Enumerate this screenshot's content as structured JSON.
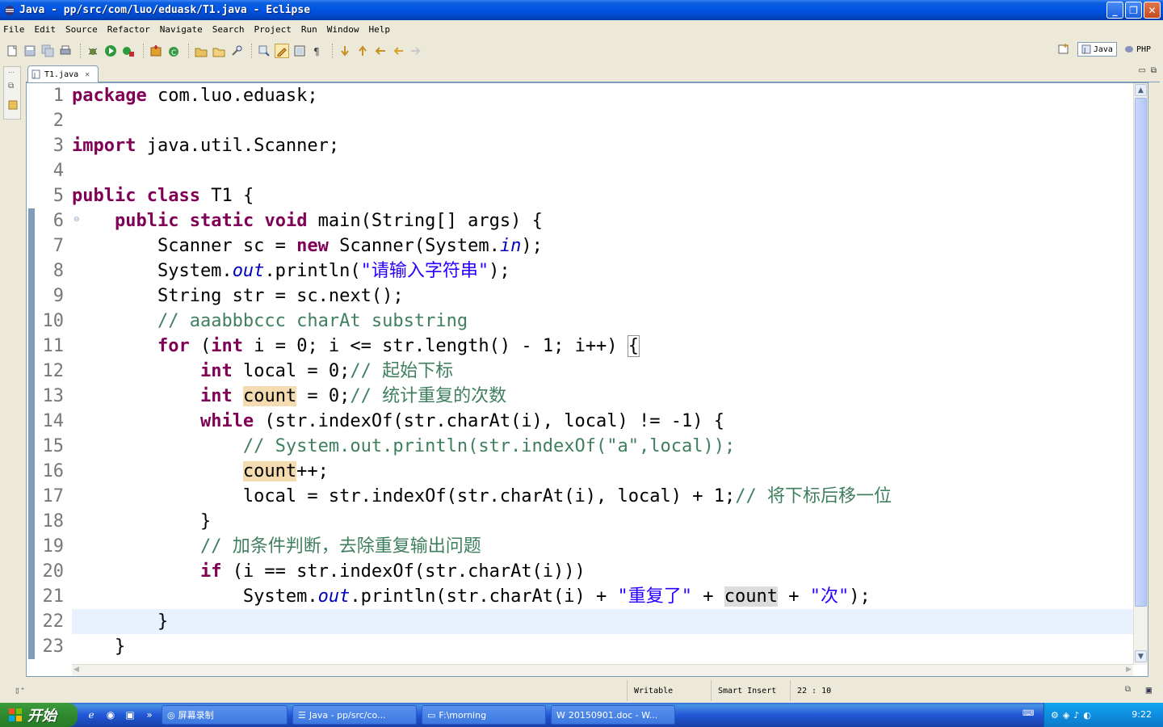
{
  "window": {
    "title": "Java - pp/src/com/luo/eduask/T1.java - Eclipse"
  },
  "menu": [
    {
      "label": "File",
      "mnemonic": "F",
      "rest": "ile"
    },
    {
      "label": "Edit",
      "mnemonic": "E",
      "rest": "dit"
    },
    {
      "label": "Source",
      "mnemonic": "S",
      "rest": "ource"
    },
    {
      "label": "Refactor",
      "mnemonic": "",
      "rest": "Refactor"
    },
    {
      "label": "Navigate",
      "mnemonic": "N",
      "rest": "avigate"
    },
    {
      "label": "Search",
      "mnemonic": "",
      "rest": "Search"
    },
    {
      "label": "Project",
      "mnemonic": "P",
      "rest": "roject"
    },
    {
      "label": "Run",
      "mnemonic": "R",
      "rest": "un"
    },
    {
      "label": "Window",
      "mnemonic": "W",
      "rest": "indow"
    },
    {
      "label": "Help",
      "mnemonic": "H",
      "rest": "elp"
    }
  ],
  "perspectives": {
    "java": "Java",
    "php": "PHP"
  },
  "editor": {
    "tab_label": "T1.java",
    "lines": [
      {
        "n": "1",
        "segs": [
          [
            "kw",
            "package"
          ],
          [
            "",
            " com.luo.eduask;"
          ]
        ]
      },
      {
        "n": "2",
        "segs": []
      },
      {
        "n": "3",
        "segs": [
          [
            "kw",
            "import"
          ],
          [
            "",
            " java.util.Scanner;"
          ]
        ]
      },
      {
        "n": "4",
        "segs": []
      },
      {
        "n": "5",
        "segs": [
          [
            "kw",
            "public"
          ],
          [
            "",
            " "
          ],
          [
            "kw",
            "class"
          ],
          [
            "",
            " T1 {"
          ]
        ]
      },
      {
        "n": "6",
        "segs": [
          [
            "",
            "    "
          ],
          [
            "kw",
            "public"
          ],
          [
            "",
            " "
          ],
          [
            "kw",
            "static"
          ],
          [
            "",
            " "
          ],
          [
            "kw",
            "void"
          ],
          [
            "",
            " main(String[] args) {"
          ]
        ]
      },
      {
        "n": "7",
        "segs": [
          [
            "",
            "        Scanner sc = "
          ],
          [
            "kw",
            "new"
          ],
          [
            "",
            " Scanner(System."
          ],
          [
            "fld",
            "in"
          ],
          [
            "",
            ");"
          ]
        ]
      },
      {
        "n": "8",
        "segs": [
          [
            "",
            "        System."
          ],
          [
            "fld",
            "out"
          ],
          [
            "",
            ".println("
          ],
          [
            "str",
            "\"请输入字符串\""
          ],
          [
            "",
            ");"
          ]
        ]
      },
      {
        "n": "9",
        "segs": [
          [
            "",
            "        String str = sc.next();"
          ]
        ]
      },
      {
        "n": "10",
        "segs": [
          [
            "",
            "        "
          ],
          [
            "cm",
            "// aaabbbccc charAt substring"
          ]
        ]
      },
      {
        "n": "11",
        "segs": [
          [
            "",
            "        "
          ],
          [
            "kw",
            "for"
          ],
          [
            "",
            " ("
          ],
          [
            "kw",
            "int"
          ],
          [
            "",
            " i = 0; i <= str.length() - 1; i++) "
          ],
          [
            "brk",
            "{"
          ]
        ]
      },
      {
        "n": "12",
        "segs": [
          [
            "",
            "            "
          ],
          [
            "kw",
            "int"
          ],
          [
            "",
            " local = 0;"
          ],
          [
            "cm",
            "// 起始下标"
          ]
        ]
      },
      {
        "n": "13",
        "segs": [
          [
            "",
            "            "
          ],
          [
            "kw",
            "int"
          ],
          [
            "",
            " "
          ],
          [
            "occ",
            "count"
          ],
          [
            "",
            " = 0;"
          ],
          [
            "cm",
            "// 统计重复的次数"
          ]
        ]
      },
      {
        "n": "14",
        "segs": [
          [
            "",
            "            "
          ],
          [
            "kw",
            "while"
          ],
          [
            "",
            " (str.indexOf(str.charAt(i), local) != -1) {"
          ]
        ]
      },
      {
        "n": "15",
        "segs": [
          [
            "",
            "                "
          ],
          [
            "cm",
            "// System.out.println(str.indexOf(\"a\",local));"
          ]
        ]
      },
      {
        "n": "16",
        "segs": [
          [
            "",
            "                "
          ],
          [
            "occ",
            "count"
          ],
          [
            "",
            "++;"
          ]
        ]
      },
      {
        "n": "17",
        "segs": [
          [
            "",
            "                local = str.indexOf(str.charAt(i), local) + 1;"
          ],
          [
            "cm",
            "// 将下标后移一位"
          ]
        ]
      },
      {
        "n": "18",
        "segs": [
          [
            "",
            "            }"
          ]
        ]
      },
      {
        "n": "19",
        "segs": [
          [
            "",
            "            "
          ],
          [
            "cm",
            "// 加条件判断，去除重复输出问题"
          ]
        ]
      },
      {
        "n": "20",
        "segs": [
          [
            "",
            "            "
          ],
          [
            "kw",
            "if"
          ],
          [
            "",
            " (i == str.indexOf(str.charAt(i)))"
          ]
        ]
      },
      {
        "n": "21",
        "segs": [
          [
            "",
            "                System."
          ],
          [
            "fld",
            "out"
          ],
          [
            "",
            ".println(str.charAt(i) + "
          ],
          [
            "str",
            "\"重复了\""
          ],
          [
            "",
            " + "
          ],
          [
            "occ2",
            "count"
          ],
          [
            "",
            " + "
          ],
          [
            "str",
            "\"次\""
          ],
          [
            "",
            ");"
          ]
        ]
      },
      {
        "n": "22",
        "segs": [
          [
            "",
            "        }"
          ]
        ]
      },
      {
        "n": "23",
        "segs": [
          [
            "",
            "    }"
          ]
        ]
      }
    ],
    "current_line": 22
  },
  "status": {
    "writable": "Writable",
    "insert_mode": "Smart Insert",
    "position": "22 : 10"
  },
  "taskbar": {
    "start": "开始",
    "tasks": [
      {
        "label": "屏幕录制",
        "active": false
      },
      {
        "label": "Java - pp/src/co...",
        "active": false
      },
      {
        "label": "F:\\morning",
        "active": false
      },
      {
        "label": "20150901.doc - W...",
        "active": false
      }
    ],
    "clock": "9:22"
  }
}
